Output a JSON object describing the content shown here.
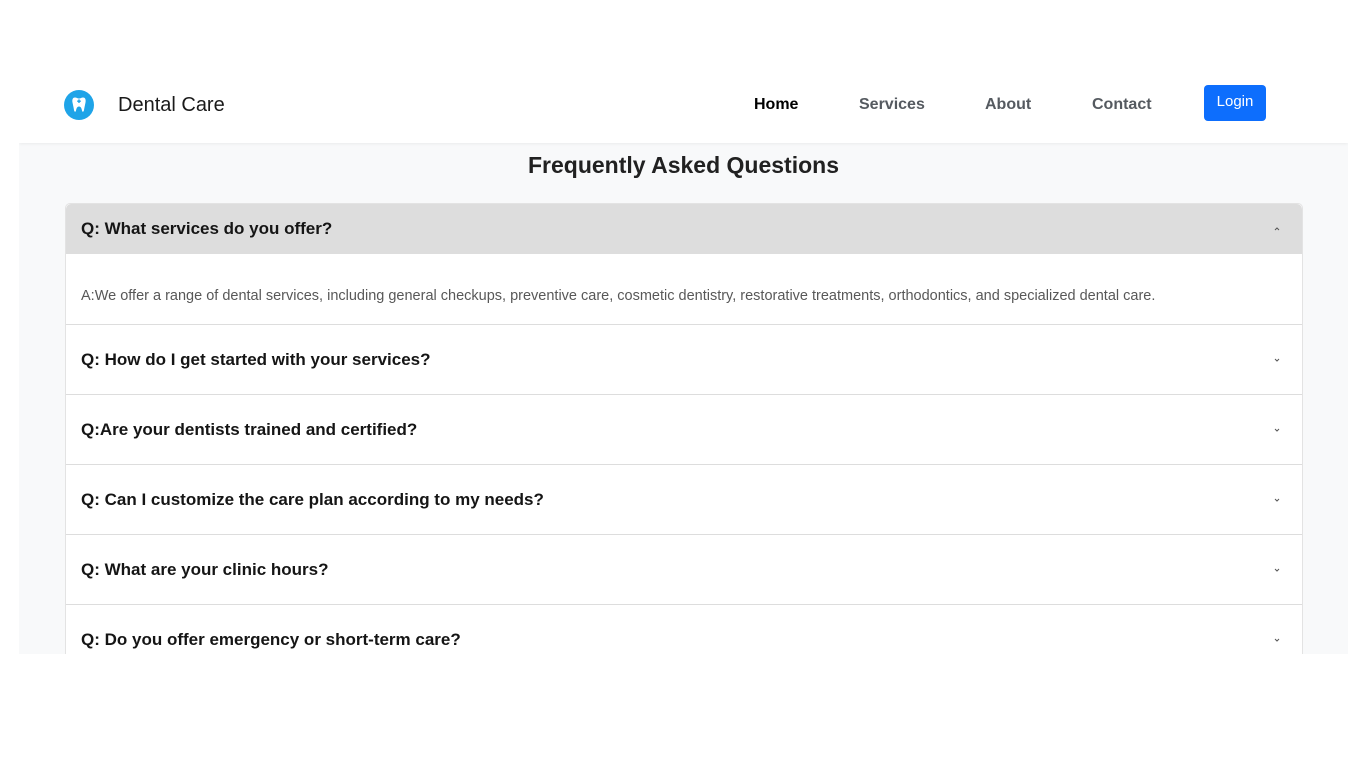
{
  "brand": {
    "name": "Dental Care",
    "logo_icon": "tooth-icon",
    "logo_color": "#1fa4e8"
  },
  "nav": {
    "items": [
      {
        "label": "Home",
        "active": true
      },
      {
        "label": "Services",
        "active": false
      },
      {
        "label": "About",
        "active": false
      },
      {
        "label": "Contact",
        "active": false
      }
    ],
    "login_label": "Login",
    "login_color": "#0d6efd"
  },
  "faq": {
    "title": "Frequently Asked Questions",
    "items": [
      {
        "question": "Q: What services do you offer?",
        "answer": "A:We offer a range of dental services, including general checkups, preventive care, cosmetic dentistry, restorative treatments, orthodontics, and specialized dental care.",
        "expanded": true,
        "icon": "chevron-up-icon"
      },
      {
        "question": "Q: How do I get started with your services?",
        "expanded": false,
        "icon": "chevron-down-icon"
      },
      {
        "question": "Q:Are your dentists trained and certified?",
        "expanded": false,
        "icon": "chevron-down-icon"
      },
      {
        "question": "Q: Can I customize the care plan according to my needs?",
        "expanded": false,
        "icon": "chevron-down-icon"
      },
      {
        "question": "Q: What are your clinic hours?",
        "expanded": false,
        "icon": "chevron-down-icon"
      },
      {
        "question": "Q: Do you offer emergency or short-term care?",
        "expanded": false,
        "icon": "chevron-down-icon"
      }
    ]
  }
}
